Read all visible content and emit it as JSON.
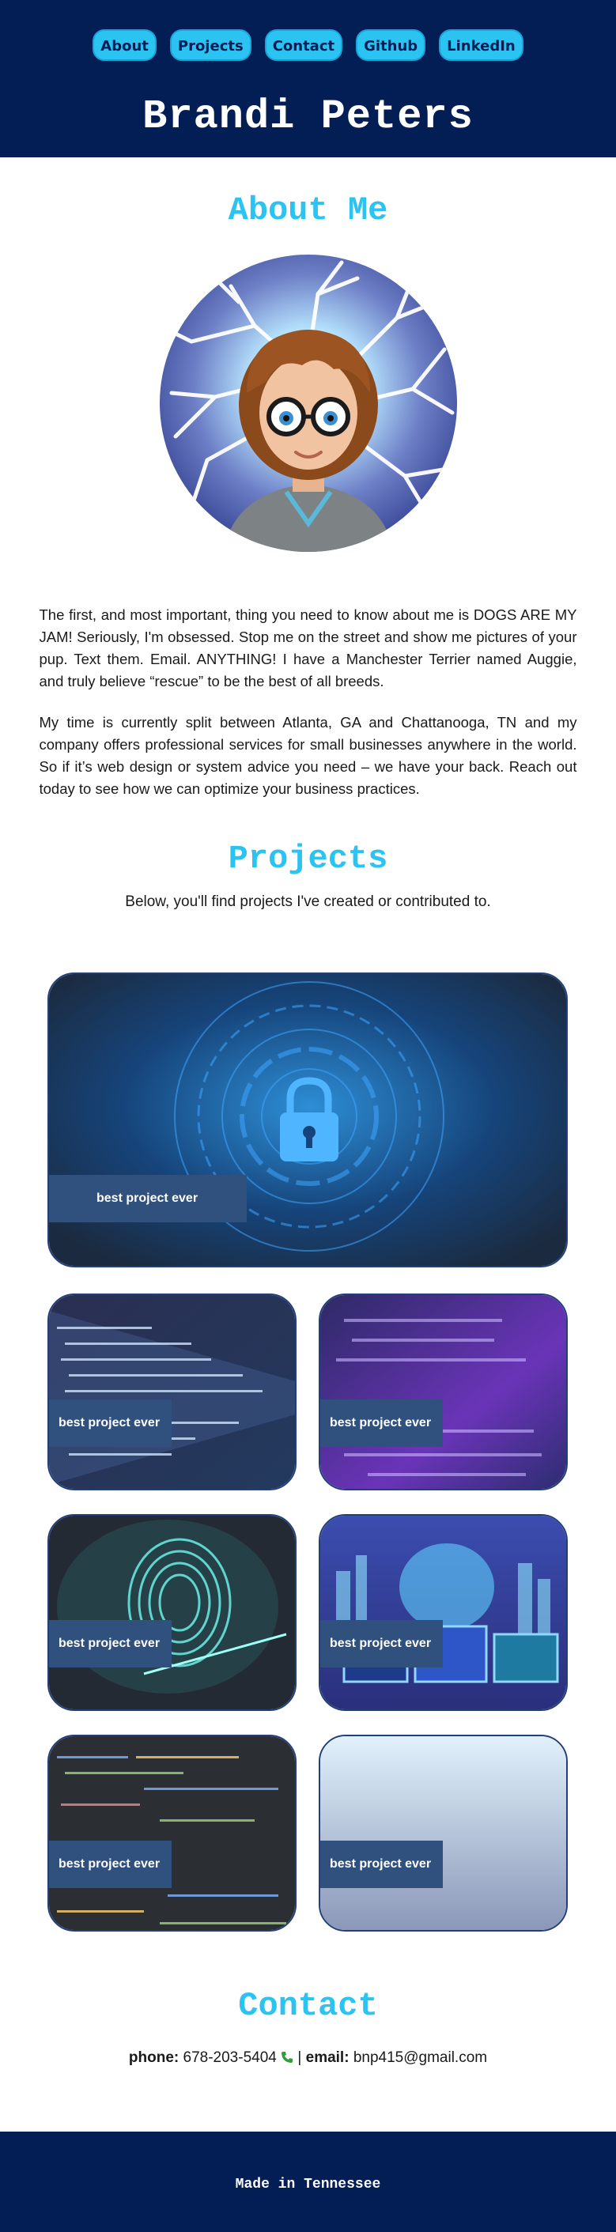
{
  "nav": {
    "items": [
      {
        "label": "About"
      },
      {
        "label": "Projects"
      },
      {
        "label": "Contact"
      },
      {
        "label": "Github"
      },
      {
        "label": "LinkedIn"
      }
    ]
  },
  "header": {
    "name": "Brandi Peters"
  },
  "about": {
    "title": "About Me",
    "paragraphs": [
      "The first, and most important, thing you need to know about me is DOGS ARE MY JAM! Seriously, I'm obsessed. Stop me on the street and show me pictures of your pup. Text them. Email. ANYTHING! I have a Manchester Terrier named Auggie, and truly believe “rescue” to be the best of all breeds.",
      "My time is currently split between Atlanta, GA and Chattanooga, TN and my company offers professional services for small businesses anywhere in the world. So if it’s web design or system advice you need – we have your back. Reach out today to see how we can optimize your business practices."
    ]
  },
  "projects": {
    "title": "Projects",
    "intro": "Below, you'll find projects I've created or contributed to.",
    "cards": [
      {
        "label": "best project ever",
        "art": "lock-cyber"
      },
      {
        "label": "best project ever",
        "art": "code-stream"
      },
      {
        "label": "best project ever",
        "art": "purple-code"
      },
      {
        "label": "best project ever",
        "art": "fingerprint"
      },
      {
        "label": "best project ever",
        "art": "city-monitors"
      },
      {
        "label": "best project ever",
        "art": "code-editor"
      },
      {
        "label": "best project ever",
        "art": "gradient-blank"
      }
    ]
  },
  "contact": {
    "title": "Contact",
    "phone_label": "phone:",
    "phone": "678-203-5404",
    "separator": "|",
    "email_label": "email:",
    "email": "bnp415@gmail.com"
  },
  "footer": {
    "text": "Made in Tennessee"
  },
  "colors": {
    "navy": "#031d55",
    "accent": "#2bc3f1",
    "label_bg": "#30507e"
  }
}
